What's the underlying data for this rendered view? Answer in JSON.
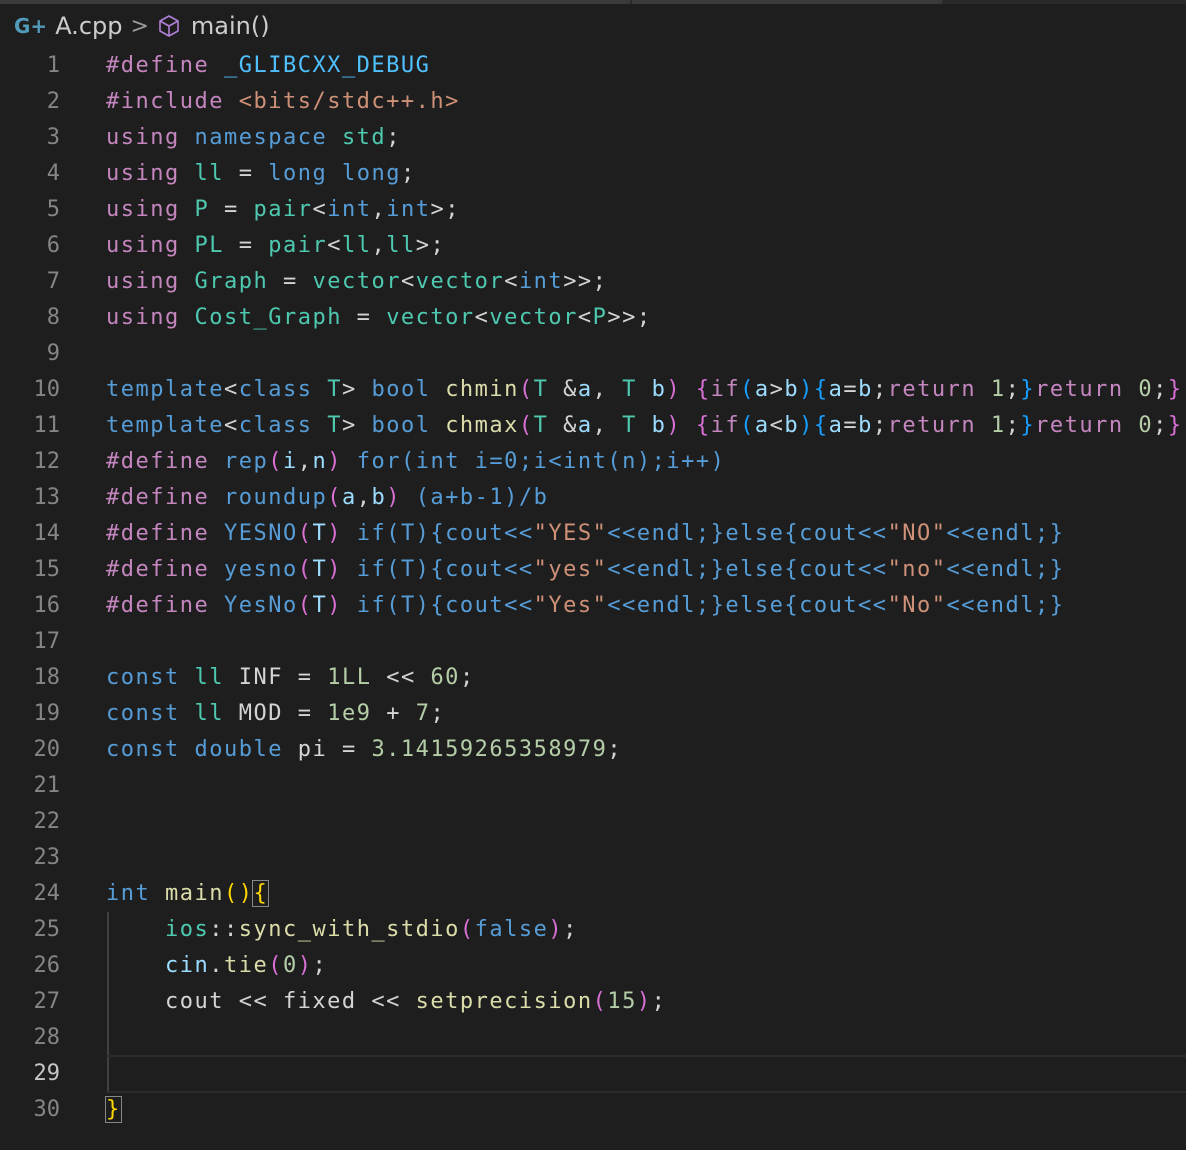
{
  "breadcrumb": {
    "file_icon": "C++",
    "file": "A.cpp",
    "separator": ">",
    "symbol_icon": "cube-icon",
    "symbol": "main()"
  },
  "editor": {
    "active_line": 29,
    "line_numbers": [
      "1",
      "2",
      "3",
      "4",
      "5",
      "6",
      "7",
      "8",
      "9",
      "10",
      "11",
      "12",
      "13",
      "14",
      "15",
      "16",
      "17",
      "18",
      "19",
      "20",
      "21",
      "22",
      "23",
      "24",
      "25",
      "26",
      "27",
      "28",
      "29",
      "30"
    ],
    "lines": [
      [
        [
          "k",
          "#define "
        ],
        [
          "m",
          "_GLIBCXX_DEBUG"
        ]
      ],
      [
        [
          "k",
          "#include "
        ],
        [
          "s",
          "<bits/stdc++.h>"
        ]
      ],
      [
        [
          "k",
          "using "
        ],
        [
          "b",
          "namespace "
        ],
        [
          "t",
          "std"
        ],
        [
          "p",
          ";"
        ]
      ],
      [
        [
          "k",
          "using "
        ],
        [
          "t",
          "ll"
        ],
        [
          "p",
          " = "
        ],
        [
          "b",
          "long long"
        ],
        [
          "p",
          ";"
        ]
      ],
      [
        [
          "k",
          "using "
        ],
        [
          "t",
          "P"
        ],
        [
          "p",
          " = "
        ],
        [
          "t",
          "pair"
        ],
        [
          "p",
          "<"
        ],
        [
          "b",
          "int"
        ],
        [
          "p",
          ","
        ],
        [
          "b",
          "int"
        ],
        [
          "p",
          ">;"
        ]
      ],
      [
        [
          "k",
          "using "
        ],
        [
          "t",
          "PL"
        ],
        [
          "p",
          " = "
        ],
        [
          "t",
          "pair"
        ],
        [
          "p",
          "<"
        ],
        [
          "t",
          "ll"
        ],
        [
          "p",
          ","
        ],
        [
          "t",
          "ll"
        ],
        [
          "p",
          ">;"
        ]
      ],
      [
        [
          "k",
          "using "
        ],
        [
          "t",
          "Graph"
        ],
        [
          "p",
          " = "
        ],
        [
          "t",
          "vector"
        ],
        [
          "p",
          "<"
        ],
        [
          "t",
          "vector"
        ],
        [
          "p",
          "<"
        ],
        [
          "b",
          "int"
        ],
        [
          "p",
          ">>;"
        ]
      ],
      [
        [
          "k",
          "using "
        ],
        [
          "t",
          "Cost_Graph"
        ],
        [
          "p",
          " = "
        ],
        [
          "t",
          "vector"
        ],
        [
          "p",
          "<"
        ],
        [
          "t",
          "vector"
        ],
        [
          "p",
          "<"
        ],
        [
          "t",
          "P"
        ],
        [
          "p",
          ">>;"
        ]
      ],
      [],
      [
        [
          "b",
          "template"
        ],
        [
          "p",
          "<"
        ],
        [
          "b",
          "class "
        ],
        [
          "t",
          "T"
        ],
        [
          "p",
          "> "
        ],
        [
          "b",
          "bool "
        ],
        [
          "f",
          "chmin"
        ],
        [
          "pu",
          "("
        ],
        [
          "t",
          "T "
        ],
        [
          "p",
          "&"
        ],
        [
          "v",
          "a"
        ],
        [
          "p",
          ", "
        ],
        [
          "t",
          "T "
        ],
        [
          "v",
          "b"
        ],
        [
          "pu",
          ")"
        ],
        [
          "p",
          " "
        ],
        [
          "pu",
          "{"
        ],
        [
          "k",
          "if"
        ],
        [
          "bl",
          "("
        ],
        [
          "v",
          "a"
        ],
        [
          "p",
          ">"
        ],
        [
          "v",
          "b"
        ],
        [
          "bl",
          ")"
        ],
        [
          "bl",
          "{"
        ],
        [
          "v",
          "a"
        ],
        [
          "p",
          "="
        ],
        [
          "v",
          "b"
        ],
        [
          "p",
          ";"
        ],
        [
          "k",
          "return "
        ],
        [
          "n",
          "1"
        ],
        [
          "p",
          ";"
        ],
        [
          "bl",
          "}"
        ],
        [
          "k",
          "return "
        ],
        [
          "n",
          "0"
        ],
        [
          "p",
          ";"
        ],
        [
          "pu",
          "}"
        ]
      ],
      [
        [
          "b",
          "template"
        ],
        [
          "p",
          "<"
        ],
        [
          "b",
          "class "
        ],
        [
          "t",
          "T"
        ],
        [
          "p",
          "> "
        ],
        [
          "b",
          "bool "
        ],
        [
          "f",
          "chmax"
        ],
        [
          "pu",
          "("
        ],
        [
          "t",
          "T "
        ],
        [
          "p",
          "&"
        ],
        [
          "v",
          "a"
        ],
        [
          "p",
          ", "
        ],
        [
          "t",
          "T "
        ],
        [
          "v",
          "b"
        ],
        [
          "pu",
          ")"
        ],
        [
          "p",
          " "
        ],
        [
          "pu",
          "{"
        ],
        [
          "k",
          "if"
        ],
        [
          "bl",
          "("
        ],
        [
          "v",
          "a"
        ],
        [
          "p",
          "<"
        ],
        [
          "v",
          "b"
        ],
        [
          "bl",
          ")"
        ],
        [
          "bl",
          "{"
        ],
        [
          "v",
          "a"
        ],
        [
          "p",
          "="
        ],
        [
          "v",
          "b"
        ],
        [
          "p",
          ";"
        ],
        [
          "k",
          "return "
        ],
        [
          "n",
          "1"
        ],
        [
          "p",
          ";"
        ],
        [
          "bl",
          "}"
        ],
        [
          "k",
          "return "
        ],
        [
          "n",
          "0"
        ],
        [
          "p",
          ";"
        ],
        [
          "pu",
          "}"
        ]
      ],
      [
        [
          "k",
          "#define "
        ],
        [
          "b",
          "rep"
        ],
        [
          "pu",
          "("
        ],
        [
          "v",
          "i"
        ],
        [
          "p",
          ","
        ],
        [
          "v",
          "n"
        ],
        [
          "pu",
          ")"
        ],
        [
          "p",
          " "
        ],
        [
          "b",
          "for(int i=0;i<int(n);i++)"
        ]
      ],
      [
        [
          "k",
          "#define "
        ],
        [
          "b",
          "roundup"
        ],
        [
          "pu",
          "("
        ],
        [
          "v",
          "a"
        ],
        [
          "p",
          ","
        ],
        [
          "v",
          "b"
        ],
        [
          "pu",
          ")"
        ],
        [
          "p",
          " "
        ],
        [
          "b",
          "(a+b-1)/b"
        ]
      ],
      [
        [
          "k",
          "#define "
        ],
        [
          "b",
          "YESNO"
        ],
        [
          "pu",
          "("
        ],
        [
          "v",
          "T"
        ],
        [
          "pu",
          ")"
        ],
        [
          "p",
          " "
        ],
        [
          "b",
          "if(T){cout<<"
        ],
        [
          "s",
          "\"YES\""
        ],
        [
          "b",
          "<<endl;}else{cout<<"
        ],
        [
          "s",
          "\"NO\""
        ],
        [
          "b",
          "<<endl;}"
        ]
      ],
      [
        [
          "k",
          "#define "
        ],
        [
          "b",
          "yesno"
        ],
        [
          "pu",
          "("
        ],
        [
          "v",
          "T"
        ],
        [
          "pu",
          ")"
        ],
        [
          "p",
          " "
        ],
        [
          "b",
          "if(T){cout<<"
        ],
        [
          "s",
          "\"yes\""
        ],
        [
          "b",
          "<<endl;}else{cout<<"
        ],
        [
          "s",
          "\"no\""
        ],
        [
          "b",
          "<<endl;}"
        ]
      ],
      [
        [
          "k",
          "#define "
        ],
        [
          "b",
          "YesNo"
        ],
        [
          "pu",
          "("
        ],
        [
          "v",
          "T"
        ],
        [
          "pu",
          ")"
        ],
        [
          "p",
          " "
        ],
        [
          "b",
          "if(T){cout<<"
        ],
        [
          "s",
          "\"Yes\""
        ],
        [
          "b",
          "<<endl;}else{cout<<"
        ],
        [
          "s",
          "\"No\""
        ],
        [
          "b",
          "<<endl;}"
        ]
      ],
      [],
      [
        [
          "b",
          "const "
        ],
        [
          "t",
          "ll"
        ],
        [
          "p",
          " INF = "
        ],
        [
          "n",
          "1LL"
        ],
        [
          "p",
          " << "
        ],
        [
          "n",
          "60"
        ],
        [
          "p",
          ";"
        ]
      ],
      [
        [
          "b",
          "const "
        ],
        [
          "t",
          "ll"
        ],
        [
          "p",
          " MOD = "
        ],
        [
          "n",
          "1e9"
        ],
        [
          "p",
          " + "
        ],
        [
          "n",
          "7"
        ],
        [
          "p",
          ";"
        ]
      ],
      [
        [
          "b",
          "const "
        ],
        [
          "b",
          "double "
        ],
        [
          "p",
          "pi = "
        ],
        [
          "n",
          "3.14159265358979"
        ],
        [
          "p",
          ";"
        ]
      ],
      [],
      [],
      [],
      [
        [
          "b",
          "int "
        ],
        [
          "f",
          "main"
        ],
        [
          "g",
          "()"
        ],
        [
          "g",
          "{"
        ]
      ],
      [
        [
          "p",
          "    "
        ],
        [
          "t",
          "ios"
        ],
        [
          "p",
          "::"
        ],
        [
          "f",
          "sync_with_stdio"
        ],
        [
          "pu",
          "("
        ],
        [
          "b",
          "false"
        ],
        [
          "pu",
          ")"
        ],
        [
          "p",
          ";"
        ]
      ],
      [
        [
          "p",
          "    "
        ],
        [
          "v",
          "cin"
        ],
        [
          "p",
          "."
        ],
        [
          "f",
          "tie"
        ],
        [
          "pu",
          "("
        ],
        [
          "n",
          "0"
        ],
        [
          "pu",
          ")"
        ],
        [
          "p",
          ";"
        ]
      ],
      [
        [
          "p",
          "    cout << fixed << "
        ],
        [
          "f",
          "setprecision"
        ],
        [
          "pu",
          "("
        ],
        [
          "n",
          "15"
        ],
        [
          "pu",
          ")"
        ],
        [
          "p",
          ";"
        ]
      ],
      [],
      [],
      [
        [
          "g",
          "}"
        ]
      ]
    ]
  }
}
